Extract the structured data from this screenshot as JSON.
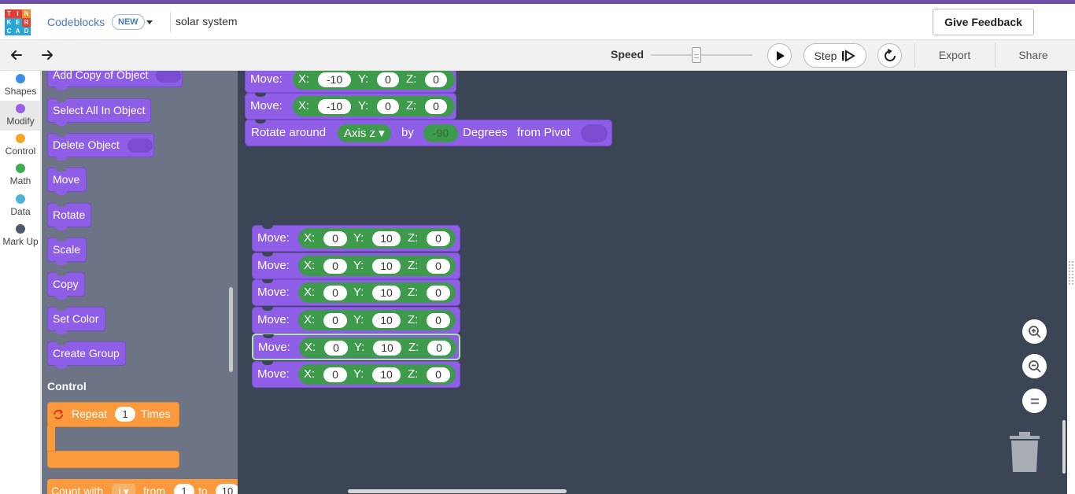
{
  "header": {
    "logo_letters": [
      "T",
      "I",
      "N",
      "K",
      "E",
      "R",
      "C",
      "A",
      "D"
    ],
    "logo_colors": [
      "#e63b2e",
      "#e63b2e",
      "#f08c2c",
      "#2aa5d8",
      "#2aa5d8",
      "#e63b2e",
      "#2aa5d8",
      "#2aa5d8",
      "#2aa5d8"
    ],
    "app_name": "Codeblocks",
    "new_badge": "NEW",
    "doc_title": "solar system",
    "feedback_label": "Give Feedback"
  },
  "toolbar": {
    "undo_icon": "undo-icon",
    "redo_icon": "redo-icon",
    "speed_label": "Speed",
    "speed_level": 0.45,
    "play_icon": "play-icon",
    "step_label": "Step",
    "reset_icon": "reset-icon",
    "export_label": "Export",
    "share_label": "Share"
  },
  "categories": [
    {
      "label": "Shapes",
      "color": "#3a8ee6"
    },
    {
      "label": "Modify",
      "color": "#9a5fe0",
      "active": true
    },
    {
      "label": "Control",
      "color": "#f5a623"
    },
    {
      "label": "Math",
      "color": "#3fae4f"
    },
    {
      "label": "Data",
      "color": "#4fb3d8"
    },
    {
      "label": "Mark Up",
      "color": "#4d5a6a"
    }
  ],
  "flyout": {
    "blocks": [
      "Add Copy of Object",
      "Select All In Object",
      "Delete Object",
      "Move",
      "Rotate",
      "Scale",
      "Copy",
      "Set Color",
      "Create Group"
    ],
    "control_heading": "Control",
    "repeat": {
      "label": "Repeat",
      "count": "1",
      "suffix": "Times"
    },
    "count_with": {
      "label": "Count with",
      "var": "i",
      "from_label": "from",
      "from_val": "1",
      "to_label": "to",
      "to_val": "10"
    }
  },
  "workspace": {
    "top_moves": [
      {
        "label": "Move:",
        "x": "-10",
        "y": "0",
        "z": "0"
      },
      {
        "label": "Move:",
        "x": "-10",
        "y": "0",
        "z": "0"
      }
    ],
    "rotate": {
      "label": "Rotate around",
      "axis": "Axis z",
      "by": "by",
      "degrees_val": "-90",
      "degrees_label": "Degrees",
      "pivot_label": "from Pivot"
    },
    "moves": [
      {
        "label": "Move:",
        "x": "0",
        "y": "10",
        "z": "0"
      },
      {
        "label": "Move:",
        "x": "0",
        "y": "10",
        "z": "0"
      },
      {
        "label": "Move:",
        "x": "0",
        "y": "10",
        "z": "0"
      },
      {
        "label": "Move:",
        "x": "0",
        "y": "10",
        "z": "0"
      },
      {
        "label": "Move:",
        "x": "0",
        "y": "10",
        "z": "0",
        "selected": true
      },
      {
        "label": "Move:",
        "x": "0",
        "y": "10",
        "z": "0"
      }
    ],
    "axis_labels": {
      "x": "X:",
      "y": "Y:",
      "z": "Z:"
    },
    "zoom_in_icon": "zoom-in-icon",
    "zoom_out_icon": "zoom-out-icon",
    "zoom_reset_icon": "zoom-reset-icon",
    "trash_icon": "trash-icon"
  }
}
